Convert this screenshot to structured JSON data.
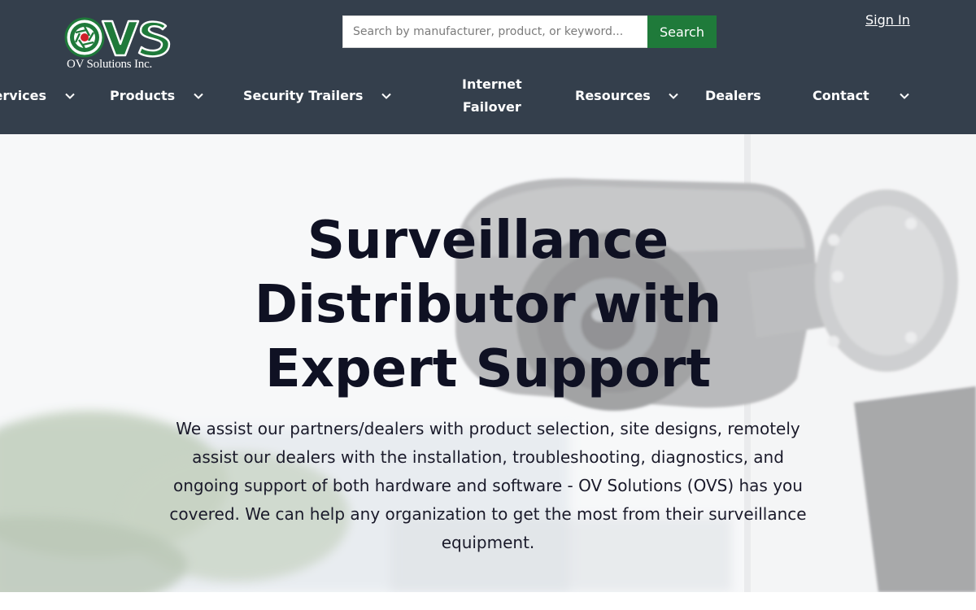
{
  "logo": {
    "letters": "OVS",
    "company_name": "OV Solutions Inc.",
    "brand_color": "#1f7a3a",
    "accent_color": "#d0202a"
  },
  "search": {
    "placeholder": "Search by manufacturer, product, or keyword...",
    "value": "",
    "button_label": "Search",
    "button_color": "#1f7a3a"
  },
  "header": {
    "signin_label": "Sign In",
    "background_color": "#343f4c"
  },
  "nav": {
    "items": [
      {
        "label": "Services",
        "has_dropdown": true
      },
      {
        "label": "Products",
        "has_dropdown": true
      },
      {
        "label": "Security Trailers",
        "has_dropdown": true
      },
      {
        "label_line1": "Internet",
        "label_line2": "Failover",
        "has_dropdown": false
      },
      {
        "label": "Resources",
        "has_dropdown": true
      },
      {
        "label": "Dealers",
        "has_dropdown": false
      },
      {
        "label": "Contact",
        "has_dropdown": true
      }
    ],
    "dropdown_icon": "chevron-down-icon"
  },
  "hero": {
    "title_line1": "Surveillance",
    "title_line2": "Distributor with",
    "title_line3": "Expert Support",
    "description": "We assist our partners/dealers with product selection, site designs, remotely assist our dealers with the installation, troubleshooting, diagnostics, and ongoing support of both hardware and software - OV Solutions (OVS) has you covered. We can help any organization to get the most from their surveillance equipment.",
    "background_image": "security-camera-photo"
  }
}
